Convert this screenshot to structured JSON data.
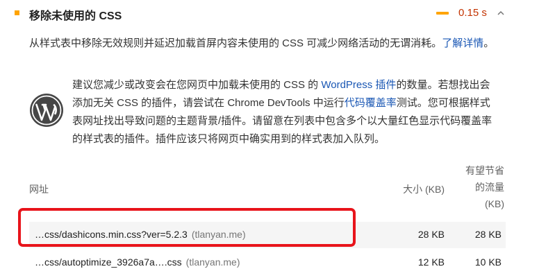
{
  "audit": {
    "title": "移除未使用的 CSS",
    "savings": "0.15 s",
    "status_color": "#ffa400",
    "savings_color": "#c33300"
  },
  "description": {
    "text": "从样式表中移除无效规则并延迟加载首屏内容未使用的 CSS 可减少网络活动的无谓消耗。",
    "link": "了解详情",
    "tail": "。"
  },
  "stack_pack": {
    "icon": "wordpress-icon",
    "text_1": "建议您减少或改变会在您网页中加载未使用的 CSS 的 ",
    "link_1": "WordPress 插件",
    "text_2": "的数量。若想找出会添加无关 CSS 的插件，请尝试在 Chrome DevTools 中运行",
    "link_2": "代码覆盖率",
    "text_3": "测试。您可根据样式表网址找出导致问题的主题背景/插件。请留意在列表中包含多个以大量红色显示代码覆盖率的样式表的插件。插件应该只将网页中确实用到的样式表加入队列。"
  },
  "table": {
    "headers": {
      "url": "网址",
      "size": "大小 (KB)",
      "savings_line1": "有望节省",
      "savings_line2": "的流量",
      "savings_line3": "(KB)"
    },
    "rows": [
      {
        "url": "…css/dashicons.min.css?ver=5.2.3",
        "host": "(tlanyan.me)",
        "size": "28 KB",
        "savings": "28 KB"
      },
      {
        "url": "…css/autoptimize_3926a7a….css",
        "host": "(tlanyan.me)",
        "size": "12 KB",
        "savings": "10 KB"
      }
    ]
  },
  "annotation": {
    "highlight_color": "#e8141b"
  }
}
